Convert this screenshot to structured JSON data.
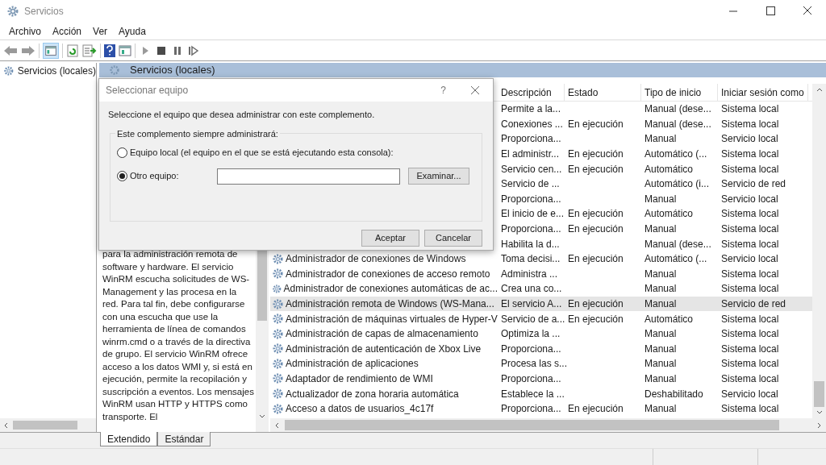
{
  "window": {
    "title": "Servicios"
  },
  "menu": [
    "Archivo",
    "Acción",
    "Ver",
    "Ayuda"
  ],
  "tree": [
    {
      "label": "Servicios (locales)"
    }
  ],
  "panel_header": "Servicios (locales)",
  "description": "para la administración remota de software y hardware. El servicio WinRM escucha solicitudes de WS-Management y las procesa en la red. Para tal fin, debe configurarse con una escucha que use la herramienta de línea de comandos winrm.cmd o a través de la directiva de grupo. El servicio WinRM ofrece acceso a los datos WMI y, si está en ejecución, permite la recopilación y suscripción a eventos. Los mensajes WinRM usan HTTP y HTTPS como transporte. El",
  "table": {
    "columns": [
      "Descripción",
      "Estado",
      "Tipo de inicio",
      "Iniciar sesión como"
    ],
    "rows": [
      {
        "description": "Permite a la...",
        "startup": "Manual (dese...",
        "logon": "Sistema local",
        "selected": false
      },
      {
        "description": "Conexiones ...",
        "status": "En ejecución",
        "startup": "Manual (dese...",
        "logon": "Sistema local",
        "selected": false
      },
      {
        "description": "Proporciona...",
        "startup": "Manual",
        "logon": "Servicio local",
        "selected": false
      },
      {
        "description": "El administr...",
        "status": "En ejecución",
        "startup": "Automático (...",
        "logon": "Sistema local",
        "selected": false
      },
      {
        "description": "Servicio cen...",
        "status": "En ejecución",
        "startup": "Automático",
        "logon": "Sistema local",
        "selected": false
      },
      {
        "description": "Servicio de ...",
        "startup": "Automático (i...",
        "logon": "Servicio de red",
        "selected": false
      },
      {
        "description": "Proporciona...",
        "startup": "Manual",
        "logon": "Servicio local",
        "selected": false
      },
      {
        "description": "El inicio de e...",
        "status": "En ejecución",
        "startup": "Automático",
        "logon": "Sistema local",
        "selected": false
      },
      {
        "description": "Proporciona...",
        "status": "En ejecución",
        "startup": "Manual",
        "logon": "Sistema local",
        "selected": false
      },
      {
        "description": "Habilita la d...",
        "startup": "Manual (dese...",
        "logon": "Sistema local",
        "selected": false
      },
      {
        "name": "Administrador de conexiones de Windows",
        "description": "Toma decisi...",
        "status": "En ejecución",
        "startup": "Automático (...",
        "logon": "Servicio local",
        "selected": false
      },
      {
        "name": "Administrador de conexiones de acceso remoto",
        "description": "Administra ...",
        "startup": "Manual",
        "logon": "Sistema local",
        "selected": false
      },
      {
        "name": "Administrador de conexiones automáticas de ac...",
        "description": "Crea una co...",
        "startup": "Manual",
        "logon": "Sistema local",
        "selected": false
      },
      {
        "name": "Administración remota de Windows (WS-Mana...",
        "description": "El servicio A...",
        "status": "En ejecución",
        "startup": "Manual",
        "logon": "Servicio de red",
        "selected": true
      },
      {
        "name": "Administración de máquinas virtuales de Hyper-V",
        "description": "Servicio de a...",
        "status": "En ejecución",
        "startup": "Automático",
        "logon": "Sistema local",
        "selected": false
      },
      {
        "name": "Administración de capas de almacenamiento",
        "description": "Optimiza la ...",
        "startup": "Manual",
        "logon": "Sistema local",
        "selected": false
      },
      {
        "name": "Administración de autenticación de Xbox Live",
        "description": "Proporciona...",
        "startup": "Manual",
        "logon": "Sistema local",
        "selected": false
      },
      {
        "name": "Administración de aplicaciones",
        "description": "Procesa las s...",
        "startup": "Manual",
        "logon": "Sistema local",
        "selected": false
      },
      {
        "name": "Adaptador de rendimiento de WMI",
        "description": "Proporciona...",
        "startup": "Manual",
        "logon": "Sistema local",
        "selected": false
      },
      {
        "name": "Actualizador de zona horaria automática",
        "description": "Establece la ...",
        "startup": "Deshabilitado",
        "logon": "Servicio local",
        "selected": false
      },
      {
        "name": "Acceso a datos de usuarios_4c17f",
        "description": "Proporciona...",
        "status": "En ejecución",
        "startup": "Manual",
        "logon": "Sistema local",
        "selected": false
      }
    ]
  },
  "view_tabs": [
    {
      "label": "Extendido",
      "selected": true
    },
    {
      "label": "Estándar",
      "selected": false
    }
  ],
  "dialog": {
    "title": "Seleccionar equipo",
    "help": "?",
    "prompt": "Seleccione el equipo que desea administrar con este complemento.",
    "group_label": "Este complemento siempre administrará:",
    "options": [
      {
        "label": "Equipo local (el equipo en el que se está ejecutando esta consola):",
        "selected": false
      },
      {
        "label": "Otro equipo:",
        "selected": true
      }
    ],
    "browse_button": "Examinar...",
    "buttons": [
      "Aceptar",
      "Cancelar"
    ]
  }
}
